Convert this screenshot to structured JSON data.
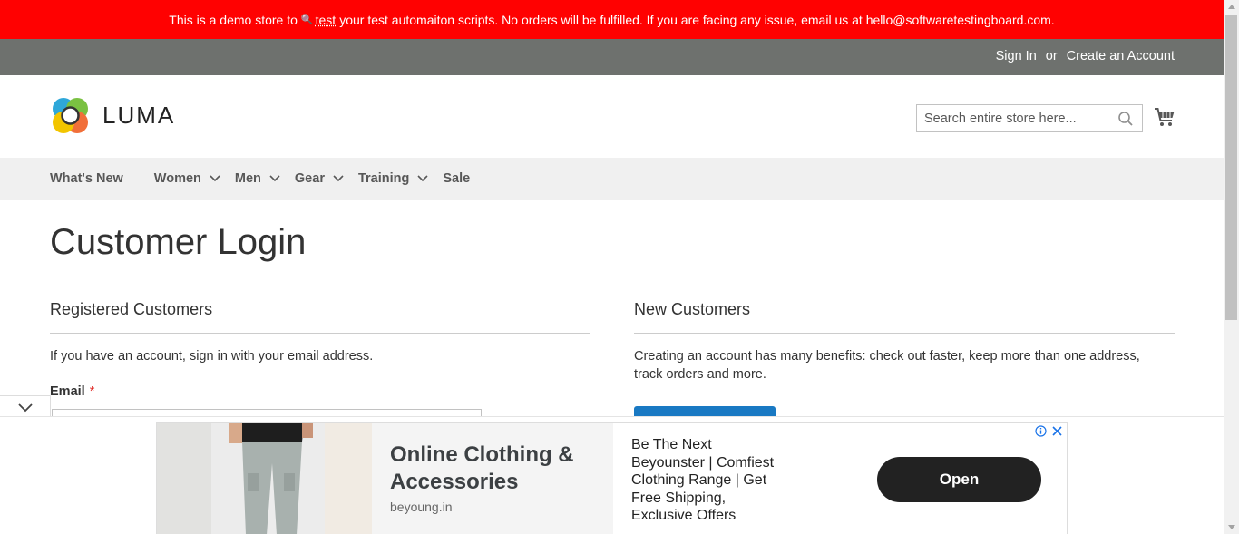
{
  "notice": {
    "before": "This is a demo store to",
    "link": "test",
    "after": "your test automaiton scripts. No orders will be fulfilled. If you are facing any issue, email us at hello@softwaretestingboard.com."
  },
  "header_links": {
    "sign_in": "Sign In",
    "or": "or",
    "create_account": "Create an Account"
  },
  "logo": {
    "text": "LUMA"
  },
  "search": {
    "placeholder": "Search entire store here..."
  },
  "nav": {
    "items": [
      {
        "label": "What's New",
        "has_dropdown": false
      },
      {
        "label": "Women",
        "has_dropdown": true
      },
      {
        "label": "Men",
        "has_dropdown": true
      },
      {
        "label": "Gear",
        "has_dropdown": true
      },
      {
        "label": "Training",
        "has_dropdown": true
      },
      {
        "label": "Sale",
        "has_dropdown": false
      }
    ]
  },
  "page": {
    "title": "Customer Login"
  },
  "registered": {
    "title": "Registered Customers",
    "intro": "If you have an account, sign in with your email address.",
    "email_label": "Email",
    "required_mark": "*"
  },
  "new_customers": {
    "title": "New Customers",
    "text": "Creating an account has many benefits: check out faster, keep more than one address, track orders and more."
  },
  "ad": {
    "headline": "Online Clothing & Accessories",
    "domain": "beyoung.in",
    "description": "Be The Next Beyounster | Comfiest Clothing Range | Get Free Shipping, Exclusive Offers",
    "cta": "Open"
  },
  "colors": {
    "notice_bg": "#ff0101",
    "header_bar": "#6e716e",
    "nav_bg": "#f0f0f0",
    "primary": "#1979c3"
  }
}
